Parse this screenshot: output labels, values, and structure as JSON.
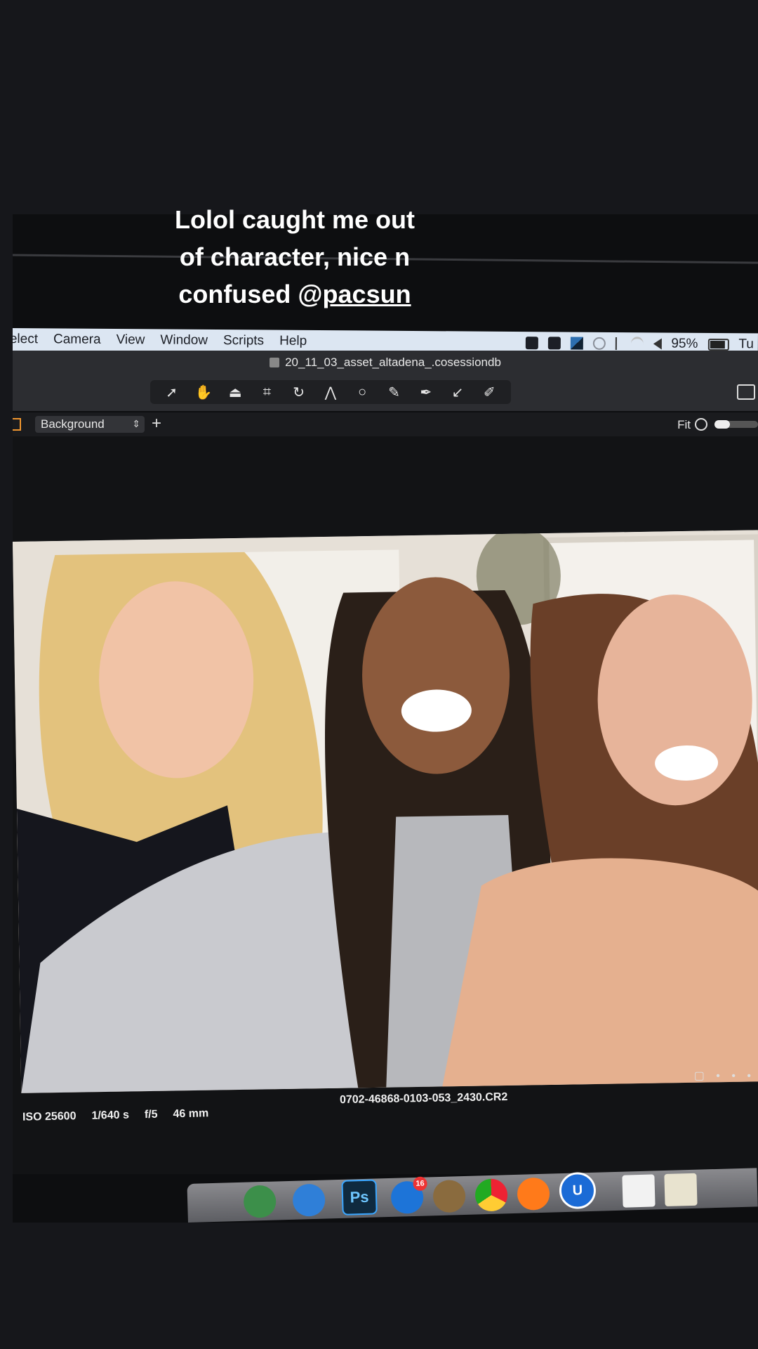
{
  "caption": {
    "line1": "Lolol caught me out",
    "line2": "of character, nice n",
    "line3_prefix": "confused @",
    "mention": "pacsun"
  },
  "menubar": {
    "items": [
      "elect",
      "Camera",
      "View",
      "Window",
      "Scripts",
      "Help"
    ],
    "battery_percent": "95%",
    "clock_fragment": "Tu"
  },
  "window": {
    "title": "20_11_03_asset_altadena_.cosessiondb"
  },
  "toolbar": {
    "tools": [
      "select-arrow",
      "pan-hand",
      "loupe",
      "crop",
      "rotate",
      "keystone",
      "circle",
      "brush",
      "pen",
      "picker",
      "eraser"
    ]
  },
  "layers": {
    "selected_layer": "Background",
    "zoom_label": "Fit"
  },
  "viewer": {
    "iso": "ISO 25600",
    "shutter": "1/640 s",
    "aperture": "f/5",
    "focal_length": "46 mm",
    "filename": "0702-46868-0103-053_2430.CR2",
    "view_icons": "▢ • • •"
  },
  "dock": {
    "ps_label": "Ps",
    "badge_count": "16",
    "u_label": "U"
  },
  "colors": {
    "accent": "#f0962f",
    "menubar": "#dce6f2",
    "toolbar": "#2c2d31"
  }
}
